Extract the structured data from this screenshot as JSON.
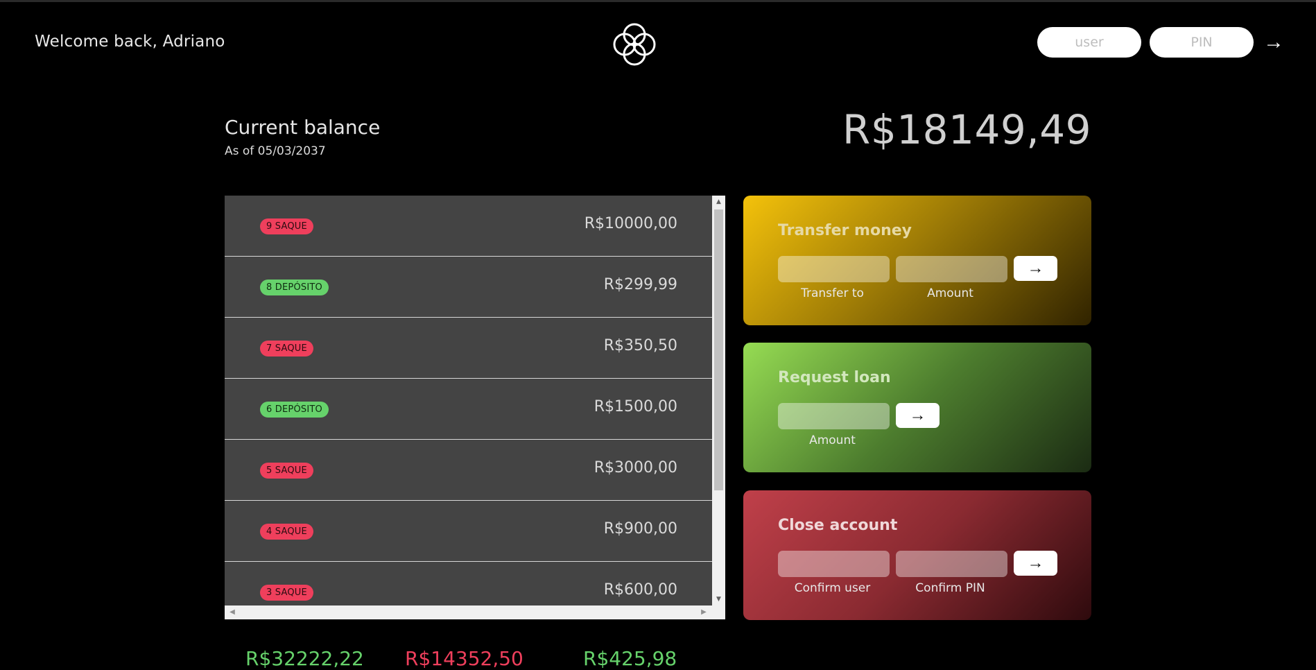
{
  "nav": {
    "welcome": "Welcome back, Adriano",
    "user_placeholder": "user",
    "pin_placeholder": "PIN",
    "login_arrow": "→"
  },
  "balance": {
    "label": "Current balance",
    "date": "As of 05/03/2037",
    "value": "R$18149,49"
  },
  "movements": [
    {
      "badge": "9 SAQUE",
      "type": "saque",
      "value": "R$10000,00"
    },
    {
      "badge": "8 DEPÓSITO",
      "type": "deposito",
      "value": "R$299,99"
    },
    {
      "badge": "7 SAQUE",
      "type": "saque",
      "value": "R$350,50"
    },
    {
      "badge": "6 DEPÓSITO",
      "type": "deposito",
      "value": "R$1500,00"
    },
    {
      "badge": "5 SAQUE",
      "type": "saque",
      "value": "R$3000,00"
    },
    {
      "badge": "4 SAQUE",
      "type": "saque",
      "value": "R$900,00"
    },
    {
      "badge": "3 SAQUE",
      "type": "saque",
      "value": "R$600,00"
    }
  ],
  "operations": {
    "transfer": {
      "title": "Transfer money",
      "label_to": "Transfer to",
      "label_amount": "Amount",
      "button": "→"
    },
    "loan": {
      "title": "Request loan",
      "label_amount": "Amount",
      "button": "→"
    },
    "close": {
      "title": "Close account",
      "label_user": "Confirm user",
      "label_pin": "Confirm PIN",
      "button": "→"
    }
  },
  "summary": {
    "in": "R$32222,22",
    "out": "R$14352,50",
    "interest": "R$425,98"
  },
  "colors": {
    "saque": "#ef3f5c",
    "deposito": "#66d26b",
    "transfer": "#f4c20b",
    "loan": "#96dc53",
    "close": "#c0404a"
  }
}
